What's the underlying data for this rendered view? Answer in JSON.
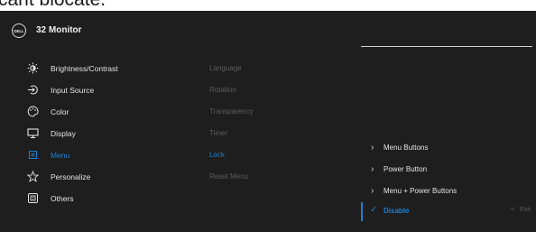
{
  "top_text": "cant blocate.",
  "header": {
    "logo_text": "DELL",
    "title": "32 Monitor"
  },
  "left_menu": [
    {
      "label": "Brightness/Contrast",
      "icon": "brightness-icon",
      "active": false
    },
    {
      "label": "Input Source",
      "icon": "input-source-icon",
      "active": false
    },
    {
      "label": "Color",
      "icon": "color-palette-icon",
      "active": false
    },
    {
      "label": "Display",
      "icon": "display-icon",
      "active": false
    },
    {
      "label": "Menu",
      "icon": "menu-icon",
      "active": true
    },
    {
      "label": "Personalize",
      "icon": "star-icon",
      "active": false
    },
    {
      "label": "Others",
      "icon": "others-icon",
      "active": false
    }
  ],
  "menu_options": [
    {
      "label": "Language",
      "active": false
    },
    {
      "label": "Rotation",
      "active": false
    },
    {
      "label": "Transparency",
      "active": false
    },
    {
      "label": "Timer",
      "active": false
    },
    {
      "label": "Lock",
      "active": true
    },
    {
      "label": "Reset Menu",
      "active": false
    }
  ],
  "lock_options": [
    {
      "label": "Menu Buttons"
    },
    {
      "label": "Power Button"
    },
    {
      "label": "Menu + Power Buttons"
    }
  ],
  "selected_option": {
    "label": "Disable",
    "icon": "check-icon"
  },
  "exit": {
    "label": "Exit",
    "icon": "chevron-left-icon"
  },
  "colors": {
    "accent": "#1a7fd1",
    "background": "#1e1e1e",
    "dim_text": "#5c5c5c"
  }
}
